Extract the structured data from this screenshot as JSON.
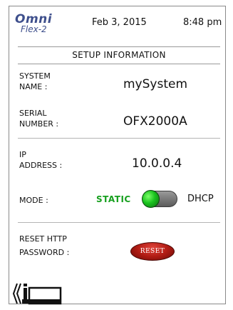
{
  "header": {
    "logo_line1": "Omni",
    "logo_line2": "Flex-2",
    "date": "Feb 3, 2015",
    "time": "8:48 pm"
  },
  "section_title": "SETUP INFORMATION",
  "fields": {
    "system_name": {
      "label_line1": "SYSTEM",
      "label_line2": "NAME :",
      "value": "mySystem"
    },
    "serial_number": {
      "label_line1": "SERIAL",
      "label_line2": "NUMBER :",
      "value": "OFX2000A"
    },
    "ip_address": {
      "label_line1": "IP",
      "label_line2": "ADDRESS :",
      "value": "10.0.0.4"
    }
  },
  "mode": {
    "label": "MODE :",
    "option_on": "STATIC",
    "option_off": "DHCP",
    "selected": "STATIC",
    "accent_color": "#17a01f"
  },
  "reset": {
    "label_line1": "RESET HTTP",
    "label_line2": "PASSWORD :",
    "button_label": "RESET",
    "button_color": "#b11c14"
  },
  "footer": {
    "back_icon": "back-info-icon"
  }
}
